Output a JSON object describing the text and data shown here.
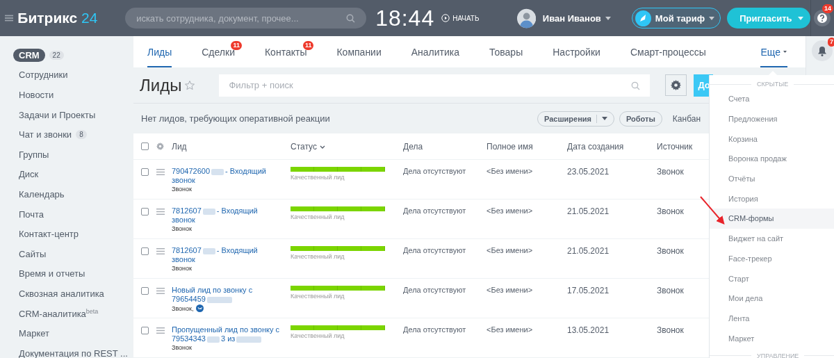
{
  "topbar": {
    "logo_text": "Битрикс",
    "logo_number": "24",
    "search_placeholder": "искать сотрудника, документ, прочее...",
    "clock": "18:44",
    "start_label": "НАЧАТЬ",
    "user_name": "Иван Иванов",
    "tariff_label": "Мой тариф",
    "invite_label": "Пригласить",
    "help_badge": "14"
  },
  "sidebar": {
    "items": [
      {
        "label": "CRM",
        "count": "22",
        "selected": true
      },
      {
        "label": "Сотрудники",
        "selected": false
      },
      {
        "label": "Новости",
        "selected": false
      },
      {
        "label": "Задачи и Проекты",
        "selected": false
      },
      {
        "label": "Чат и звонки",
        "count": "8",
        "selected": false
      },
      {
        "label": "Группы",
        "selected": false
      },
      {
        "label": "Диск",
        "selected": false
      },
      {
        "label": "Календарь",
        "selected": false
      },
      {
        "label": "Почта",
        "selected": false
      },
      {
        "label": "Контакт-центр",
        "selected": false
      },
      {
        "label": "Сайты",
        "selected": false
      },
      {
        "label": "Время и отчеты",
        "selected": false
      },
      {
        "label": "Сквозная аналитика",
        "selected": false
      },
      {
        "label": "CRM-аналитика$^{beta}$",
        "selected": false
      },
      {
        "label": "Маркет",
        "selected": false
      },
      {
        "label": "Документация по REST ...",
        "selected": false
      }
    ]
  },
  "tabs": [
    {
      "label": "Лиды",
      "selected": true
    },
    {
      "label": "Сделки",
      "badge": "11",
      "selected": false
    },
    {
      "label": "Контакты",
      "badge": "11",
      "selected": false
    },
    {
      "label": "Компании",
      "selected": false
    },
    {
      "label": "Аналитика",
      "selected": false
    },
    {
      "label": "Товары",
      "selected": false
    },
    {
      "label": "Настройки",
      "selected": false
    },
    {
      "label": "Смарт-процессы",
      "selected": false
    }
  ],
  "more_tab": {
    "label": "Еще",
    "expanded": true
  },
  "notifications": {
    "bell_badge": "7"
  },
  "page": {
    "title": "Лиды",
    "filter_placeholder": "Фильтр + поиск",
    "add_button": "До"
  },
  "toolbar": {
    "notice": "Нет лидов, требующих оперативной реакции",
    "extensions": "Расширения",
    "robots": "Роботы",
    "kanban": "Канбан"
  },
  "table": {
    "select_all_checked": false,
    "columns": [
      "Лид",
      "Статус",
      "Дела",
      "Полное имя",
      "Дата создания",
      "Источник"
    ],
    "rows": [
      {
        "checked": false,
        "title_parts": [
          "790472600",
          "- Входящий звонок"
        ],
        "redacted_end": false,
        "source_note": "Звонок",
        "vk_icon": false,
        "status": "Качественный лид",
        "level": 1,
        "tasks": "Дела отсутствуют",
        "name": "<Без имени>",
        "date": "23.05.2021",
        "source": "Звонок"
      },
      {
        "checked": false,
        "title_parts": [
          "7812607",
          "- Входящий звонок"
        ],
        "redacted_end": false,
        "source_note": "Звонок",
        "vk_icon": false,
        "status": "Качественный лид",
        "level": 1,
        "tasks": "Дела отсутствуют",
        "name": "<Без имени>",
        "date": "21.05.2021",
        "source": "Звонок"
      },
      {
        "checked": false,
        "title_parts": [
          "7812607",
          "- Входящий звонок"
        ],
        "redacted_end": false,
        "source_note": "Звонок",
        "vk_icon": false,
        "status": "Качественный лид",
        "level": 1,
        "tasks": "Дела отсутствуют",
        "name": "<Без имени>",
        "date": "21.05.2021",
        "source": "Звонок"
      },
      {
        "checked": false,
        "title_parts": [
          "Новый лид по звонку с 79654459"
        ],
        "redacted_end": true,
        "source_note": "Звонок,",
        "vk_icon": true,
        "status": "Качественный лид",
        "level": 1,
        "tasks": "Дела отсутствуют",
        "name": "<Без имени>",
        "date": "17.05.2021",
        "source": "Звонок"
      },
      {
        "checked": false,
        "title_parts": [
          "Пропущенный лид по звонку с 79534343",
          "3 из"
        ],
        "redacted_end": true,
        "source_note": "Звонок",
        "vk_icon": false,
        "status": "Качественный лид",
        "level": 1,
        "tasks": "Дела отсутствуют",
        "name": "<Без имени>",
        "date": "13.05.2021",
        "source": "Звонок"
      }
    ]
  },
  "more_menu": {
    "header": "СКРЫТЫЕ",
    "items": [
      {
        "label": "Счета",
        "selected": false
      },
      {
        "label": "Предложения",
        "selected": false
      },
      {
        "label": "Корзина",
        "selected": false
      },
      {
        "label": "Воронка продаж",
        "selected": false
      },
      {
        "label": "Отчёты",
        "selected": false
      },
      {
        "label": "История",
        "selected": false
      },
      {
        "label": "CRM-формы",
        "selected": true
      },
      {
        "label": "Виджет на сайт",
        "selected": false
      },
      {
        "label": "Face-трекер",
        "selected": false
      },
      {
        "label": "Старт",
        "selected": false
      },
      {
        "label": "Мои дела",
        "selected": false
      },
      {
        "label": "Лента",
        "selected": false
      },
      {
        "label": "Маркет",
        "selected": false
      }
    ],
    "footer": "УПРАВЛЕНИЕ"
  }
}
